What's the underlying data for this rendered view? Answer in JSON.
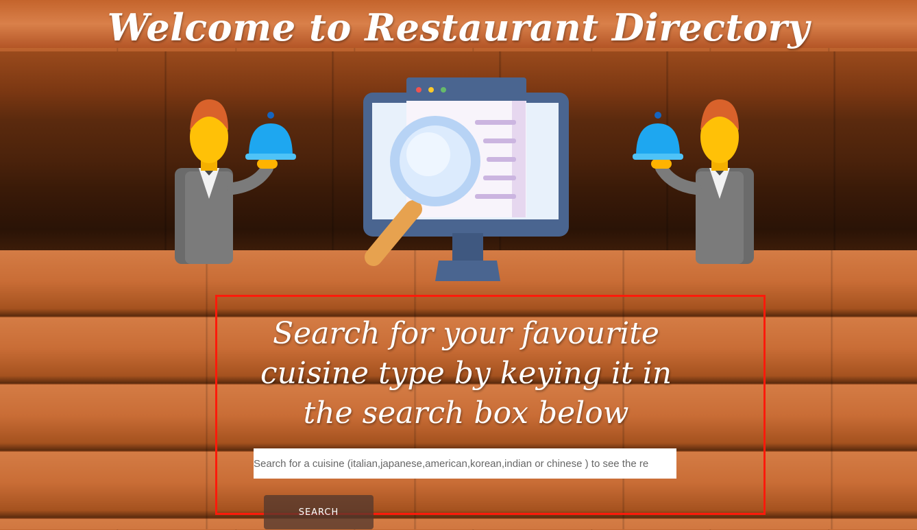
{
  "page": {
    "welcome_title": "Welcome to Restaurant Directory",
    "search_heading": "Search for your favourite cuisine type by keying it in the search box below"
  },
  "search": {
    "placeholder": "Search for a cuisine (italian,japanese,american,korean,indian or chinese ) to see the re",
    "button_label": "SEARCH"
  },
  "icons": {
    "waiter_left": "waiter-with-cloche-icon",
    "monitor": "monitor-magnifier-icon",
    "waiter_right": "waiter-with-cloche-icon"
  },
  "colors": {
    "highlight_border": "#ff1a0a",
    "cloche": "#1ea7f0",
    "monitor_frame": "#4a6590",
    "magnifier_handle": "#e7a24f"
  }
}
